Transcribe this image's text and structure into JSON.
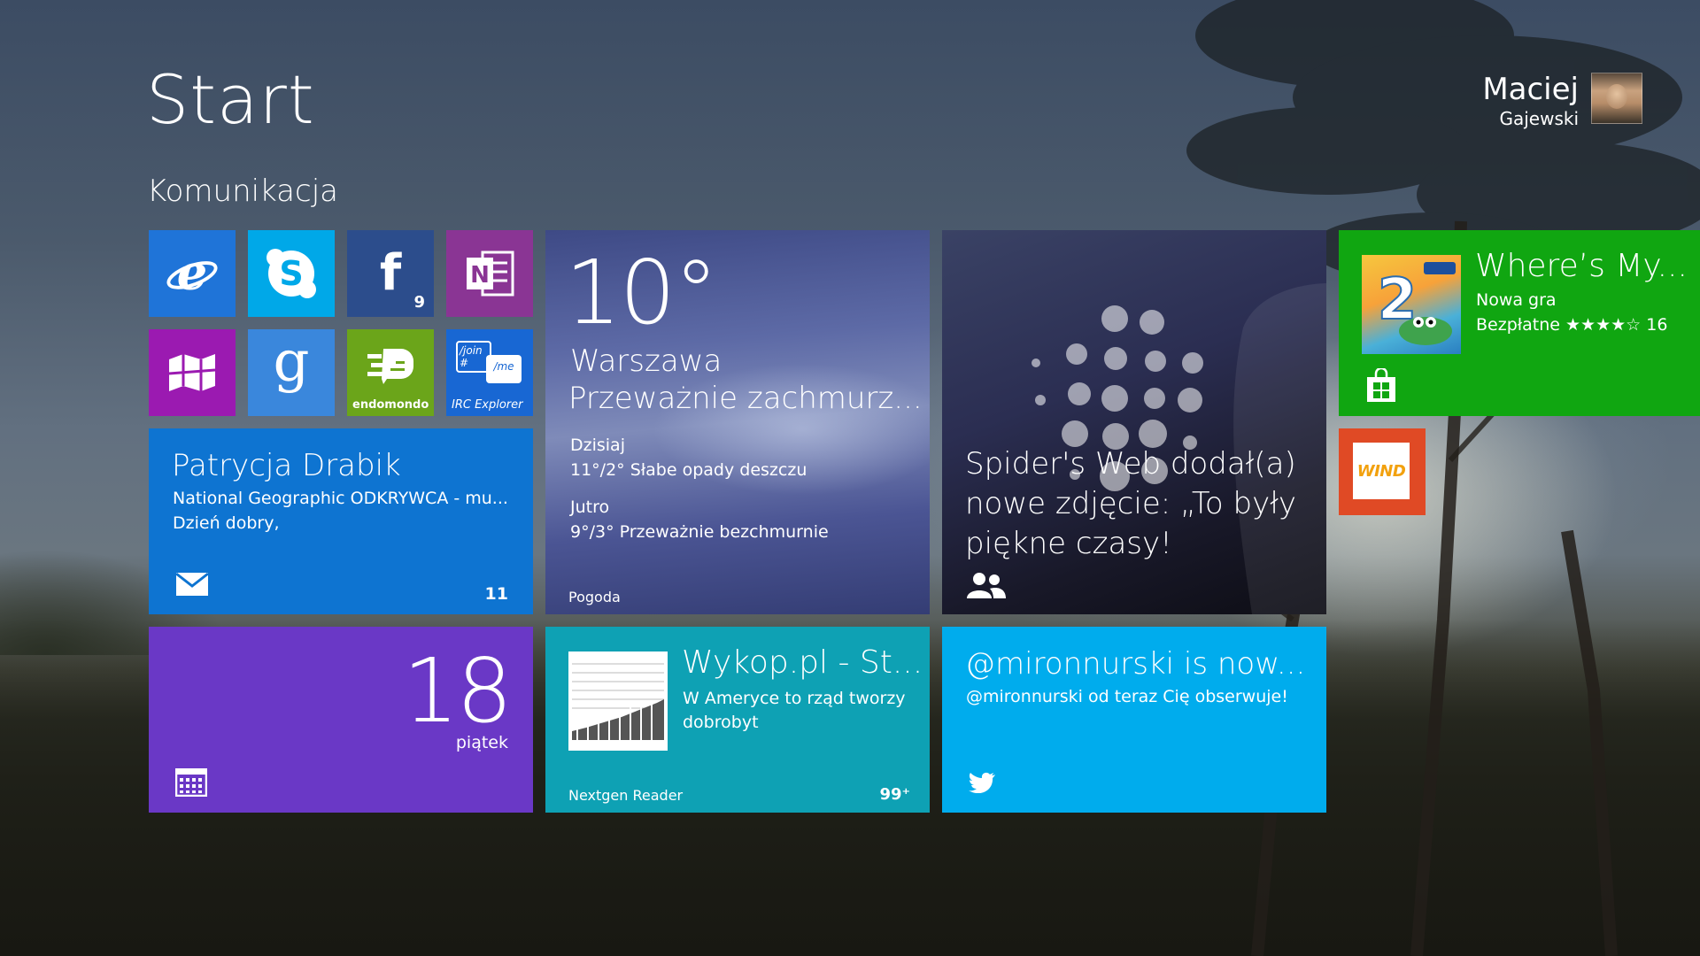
{
  "header": {
    "title": "Start",
    "group_title": "Komunikacja"
  },
  "user": {
    "first_name": "Maciej",
    "last_name": "Gajewski",
    "avatar_icon": "user-avatar"
  },
  "colors": {
    "ie": "#1f74d8",
    "skype": "#00a8e8",
    "facebook": "#2c4d8c",
    "onenote": "#8a3594",
    "maps": "#9b1ab1",
    "google": "#3a87dc",
    "endomondo": "#6ba51a",
    "irc": "#1867d3",
    "mail": "#0e74d1",
    "calendar": "#6a38c6",
    "reader": "#0ea1b4",
    "twitter": "#00aced",
    "store": "#10a611",
    "wind": "#e04a25"
  },
  "tiles": {
    "ie": {
      "icon": "internet-explorer-icon"
    },
    "skype": {
      "icon": "skype-icon"
    },
    "facebook": {
      "icon": "facebook-icon",
      "badge": "9"
    },
    "onenote": {
      "icon": "onenote-icon"
    },
    "maps": {
      "icon": "maps-icon"
    },
    "google": {
      "icon": "google-icon"
    },
    "endomondo": {
      "icon": "endomondo-icon",
      "label": "endomondo"
    },
    "irc": {
      "icon": "irc-explorer-icon",
      "label": "IRC Explorer",
      "bubble1": "/join #",
      "bubble2": "/me"
    },
    "mail": {
      "sender": "Patrycja Drabik",
      "subject": "National Geographic ODKRYWCA - mu...",
      "preview": "Dzień dobry,",
      "count": "11",
      "icon": "mail-icon"
    },
    "weather": {
      "temperature": "10°",
      "city": "Warszawa",
      "condition": "Przeważnie zachmurz...",
      "today_label": "Dzisiaj",
      "today_forecast": "11°/2° Słabe opady deszczu",
      "tomorrow_label": "Jutro",
      "tomorrow_forecast": "9°/3° Przeważnie bezchmurnie",
      "app_name": "Pogoda"
    },
    "people": {
      "text": "Spider's Web dodał(a) nowe zdjęcie: „To były piękne czasy!",
      "icon": "people-icon"
    },
    "store": {
      "app_name": "Where’s My...",
      "subtitle": "Nowa gra",
      "rating_text": "Bezpłatne ★★★★☆ 16",
      "icon": "store-icon",
      "image_icon": "wheres-my-water-2-icon"
    },
    "wind": {
      "logo_text": "WIND",
      "icon": "wind-logo-icon"
    },
    "calendar": {
      "day_number": "18",
      "weekday": "piątek",
      "icon": "calendar-icon"
    },
    "reader": {
      "title": "Wykop.pl - St...",
      "subtitle": "W Ameryce to rząd tworzy dobrobyt",
      "app_name": "Nextgen Reader",
      "count": "99⁺"
    },
    "twitter": {
      "title": "@mironnurski is now...",
      "subtitle": "@mironnurski od teraz Cię obserwuje!",
      "icon": "twitter-icon"
    }
  }
}
